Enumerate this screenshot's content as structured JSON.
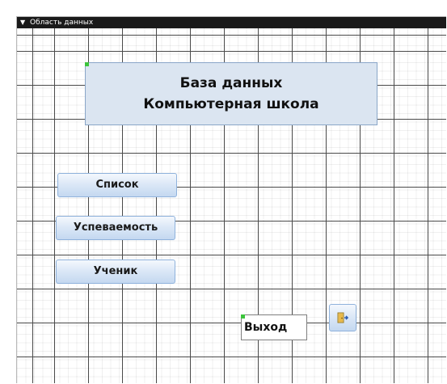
{
  "section": {
    "header_label": "Область данных",
    "chevron_icon": "chevron-down-icon"
  },
  "form": {
    "title_line1": "База данных",
    "title_line2": "Компьютерная школа",
    "buttons": [
      {
        "label": "Список"
      },
      {
        "label": "Успеваемость"
      },
      {
        "label": "Ученик"
      }
    ],
    "exit_label": "Выход",
    "exit_icon": "exit-door-icon"
  },
  "colors": {
    "title_background": "#dbe5f1",
    "button_gradient_top": "#f4f8fd",
    "button_gradient_bottom": "#c4d8f0",
    "header_background": "#1a1a1a",
    "grid_line": "#4a4a4a",
    "selection_marker": "#3cc43c"
  }
}
